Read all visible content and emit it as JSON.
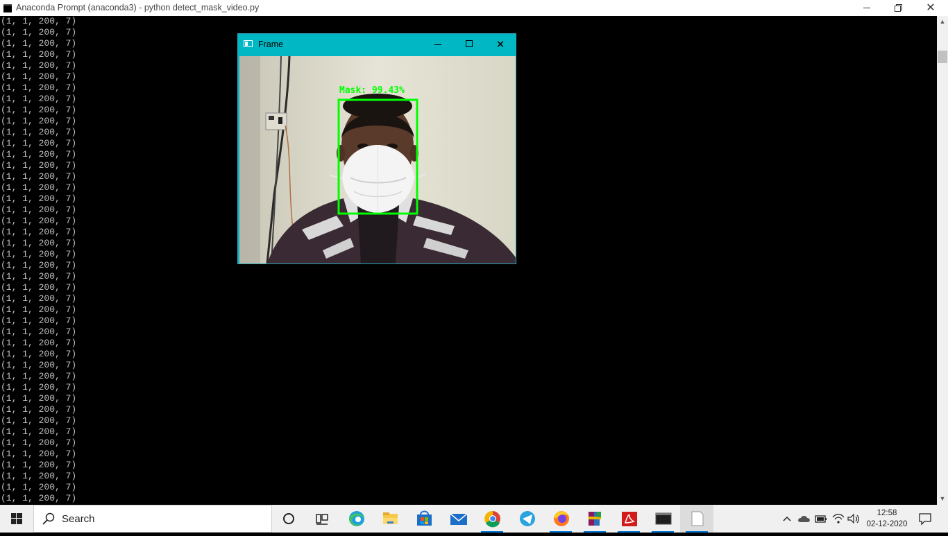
{
  "window": {
    "title": "Anaconda Prompt (anaconda3) - python  detect_mask_video.py",
    "minimize_label": "Minimize",
    "restore_label": "Restore",
    "close_glyph": "✕"
  },
  "console": {
    "lines": [
      "(1, 1, 200, 7)",
      "(1, 1, 200, 7)",
      "(1, 1, 200, 7)",
      "(1, 1, 200, 7)",
      "(1, 1, 200, 7)",
      "(1, 1, 200, 7)",
      "(1, 1, 200, 7)",
      "(1, 1, 200, 7)",
      "(1, 1, 200, 7)",
      "(1, 1, 200, 7)",
      "(1, 1, 200, 7)",
      "(1, 1, 200, 7)",
      "(1, 1, 200, 7)",
      "(1, 1, 200, 7)",
      "(1, 1, 200, 7)",
      "(1, 1, 200, 7)",
      "(1, 1, 200, 7)",
      "(1, 1, 200, 7)",
      "(1, 1, 200, 7)",
      "(1, 1, 200, 7)",
      "(1, 1, 200, 7)",
      "(1, 1, 200, 7)",
      "(1, 1, 200, 7)",
      "(1, 1, 200, 7)",
      "(1, 1, 200, 7)",
      "(1, 1, 200, 7)",
      "(1, 1, 200, 7)",
      "(1, 1, 200, 7)",
      "(1, 1, 200, 7)",
      "(1, 1, 200, 7)",
      "(1, 1, 200, 7)",
      "(1, 1, 200, 7)",
      "(1, 1, 200, 7)",
      "(1, 1, 200, 7)",
      "(1, 1, 200, 7)",
      "(1, 1, 200, 7)",
      "(1, 1, 200, 7)",
      "(1, 1, 200, 7)",
      "(1, 1, 200, 7)",
      "(1, 1, 200, 7)",
      "(1, 1, 200, 7)",
      "(1, 1, 200, 7)",
      "(1, 1, 200, 7)",
      "(1, 1, 200, 7)"
    ]
  },
  "frame_window": {
    "title": "Frame",
    "detection_label": "Mask: 99.43%",
    "box_color": "#00ff00"
  },
  "taskbar": {
    "search_text": "Search",
    "apps": [
      {
        "name": "cortana-icon"
      },
      {
        "name": "task-view-icon"
      },
      {
        "name": "edge-icon"
      },
      {
        "name": "file-explorer-icon"
      },
      {
        "name": "microsoft-store-icon"
      },
      {
        "name": "mail-icon"
      },
      {
        "name": "chrome-icon"
      },
      {
        "name": "telegram-icon"
      },
      {
        "name": "firefox-icon"
      },
      {
        "name": "winrar-icon"
      },
      {
        "name": "acrobat-icon"
      },
      {
        "name": "terminal-icon"
      },
      {
        "name": "notepad-icon"
      }
    ],
    "clock_time": "12:58",
    "clock_date": "02-12-2020"
  },
  "colors": {
    "accent": "#00b7c3",
    "taskbar_bg": "#f0f0f0",
    "console_bg": "#000000",
    "console_text": "#c0c0c0"
  }
}
